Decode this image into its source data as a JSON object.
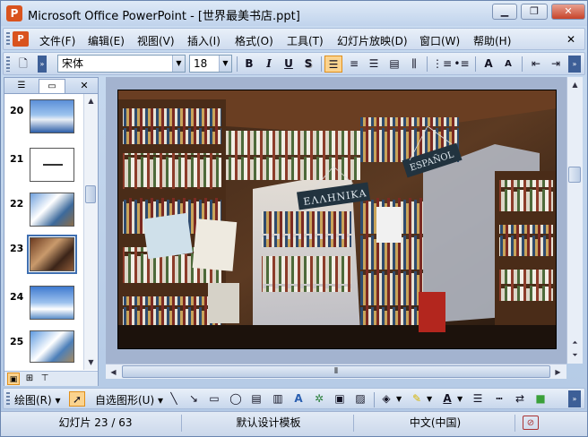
{
  "window": {
    "title": "Microsoft Office PowerPoint - [世界最美书店.ppt]",
    "app_icon_glyph": "P"
  },
  "menu": {
    "items": [
      "文件(F)",
      "编辑(E)",
      "视图(V)",
      "插入(I)",
      "格式(O)",
      "工具(T)",
      "幻灯片放映(D)",
      "窗口(W)",
      "帮助(H)"
    ],
    "close_glyph": "✕"
  },
  "format_toolbar": {
    "font_name": "宋体",
    "font_size": "18",
    "bold": "B",
    "italic": "I",
    "underline": "U",
    "shadow": "S",
    "increase_font": "A",
    "decrease_font": "A"
  },
  "slides_panel": {
    "items": [
      {
        "number": "20",
        "thumb": "ocean"
      },
      {
        "number": "21",
        "thumb": "blank"
      },
      {
        "number": "22",
        "thumb": "buildings"
      },
      {
        "number": "23",
        "thumb": "bookstore",
        "selected": true
      },
      {
        "number": "24",
        "thumb": "ocean"
      },
      {
        "number": "25",
        "thumb": "buildings"
      }
    ]
  },
  "slide": {
    "sign_left": "ΕΛΛΗΝΙΚΑ",
    "sign_right": "ESPAÑOL"
  },
  "draw_toolbar": {
    "draw_label": "绘图(R)",
    "autoshapes_label": "自选图形(U)"
  },
  "status": {
    "slide_info": "幻灯片 23 / 63",
    "template": "默认设计模板",
    "language": "中文(中国)"
  },
  "colors": {
    "accent": "#3f6fb0",
    "active_button": "#fbd38e",
    "close_button": "#c7442a"
  }
}
